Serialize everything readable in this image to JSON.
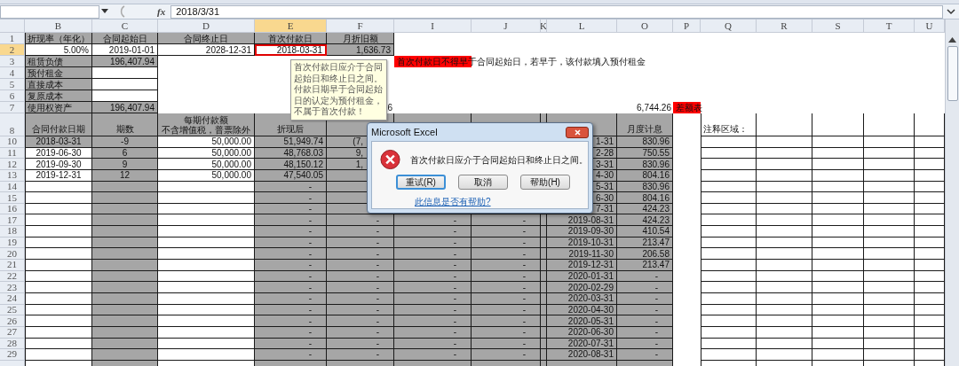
{
  "formula_bar": {
    "function_label": "fx",
    "formula": "2018/3/31"
  },
  "columns": [
    {
      "label": "B",
      "selected": false,
      "data_shaded": false,
      "bordered": true
    },
    {
      "label": "C",
      "selected": false,
      "data_shaded": true,
      "bordered": true
    },
    {
      "label": "D",
      "selected": false,
      "data_shaded": false,
      "bordered": true
    },
    {
      "label": "E",
      "selected": true,
      "data_shaded": true,
      "bordered": true
    },
    {
      "label": "F",
      "selected": false,
      "data_shaded": true,
      "bordered": true
    },
    {
      "label": "I",
      "selected": false,
      "data_shaded": true,
      "bordered": true
    },
    {
      "label": "J",
      "selected": false,
      "data_shaded": true,
      "bordered": true
    },
    {
      "label": "K",
      "selected": false,
      "data_shaded": true,
      "bordered": true
    },
    {
      "label": "L",
      "selected": false,
      "data_shaded": true,
      "bordered": true
    },
    {
      "label": "O",
      "selected": false,
      "data_shaded": true,
      "bordered": true
    },
    {
      "label": "P",
      "selected": false,
      "data_shaded": false,
      "bordered": false
    },
    {
      "label": "Q",
      "selected": false,
      "data_shaded": false,
      "bordered": true
    },
    {
      "label": "R",
      "selected": false,
      "data_shaded": false,
      "bordered": true
    },
    {
      "label": "S",
      "selected": false,
      "data_shaded": false,
      "bordered": true
    },
    {
      "label": "T",
      "selected": false,
      "data_shaded": false,
      "bordered": true
    },
    {
      "label": "U",
      "selected": false,
      "data_shaded": false,
      "bordered": true
    }
  ],
  "rows": [
    {
      "header": "1",
      "selected": false,
      "kind": "top",
      "cells": {
        "B": {
          "text": "折现率（年化）",
          "kind": "heading",
          "shaded": true
        },
        "C": {
          "text": "合同起始日",
          "kind": "heading",
          "shaded": true
        },
        "D": {
          "text": "合同终止日",
          "kind": "heading",
          "shaded": true
        },
        "E": {
          "text": "首次付款日",
          "kind": "heading",
          "shaded": true
        },
        "F": {
          "text": "月折旧额",
          "kind": "heading",
          "shaded": true
        }
      }
    },
    {
      "header": "2",
      "selected": true,
      "kind": "top",
      "cells": {
        "B": {
          "text": "5.00%",
          "kind": "value",
          "shaded": false
        },
        "C": {
          "text": "2019-01-01",
          "kind": "value",
          "shaded": false
        },
        "D": {
          "text": "2028-12-31",
          "kind": "value",
          "shaded": false
        },
        "E": {
          "text": "2018-03-31",
          "kind": "value",
          "shaded": false,
          "active": true
        },
        "F": {
          "text": "1,636.73",
          "kind": "value",
          "shaded": true
        }
      }
    },
    {
      "header": "3",
      "selected": false,
      "kind": "top",
      "cells": {
        "B": {
          "text": "租赁负债",
          "kind": "label",
          "shaded": true
        },
        "C": {
          "text": "196,407.94",
          "kind": "value",
          "shaded": true
        },
        "I": {
          "text": "首次付款日不得早于合同起始日，若早于，该付款填入预付租金",
          "kind": "note",
          "color": "#ff0000"
        }
      }
    },
    {
      "header": "4",
      "selected": false,
      "kind": "top",
      "cells": {
        "B": {
          "text": "预付租金",
          "kind": "label",
          "shaded": true
        },
        "C": {
          "kind": "value",
          "shaded": false
        }
      }
    },
    {
      "header": "5",
      "selected": false,
      "kind": "top",
      "cells": {
        "B": {
          "text": "直接成本",
          "kind": "label",
          "shaded": true
        },
        "C": {
          "kind": "value",
          "shaded": false
        }
      }
    },
    {
      "header": "6",
      "selected": false,
      "kind": "top",
      "cells": {
        "B": {
          "text": "复原成本",
          "kind": "label",
          "shaded": true
        },
        "C": {
          "kind": "value",
          "shaded": false
        }
      }
    },
    {
      "header": "7",
      "selected": false,
      "kind": "top",
      "cells": {
        "B": {
          "text": "使用权资产",
          "kind": "label",
          "shaded": true
        },
        "C": {
          "text": "196,407.94",
          "kind": "value",
          "shaded": true
        },
        "F": {
          "text": "6",
          "kind": "plain"
        },
        "O": {
          "text": "6,744.26",
          "kind": "plain"
        },
        "P": {
          "text": "差额表",
          "kind": "note",
          "color": "#ff0000"
        }
      }
    },
    {
      "header": "8",
      "selected": false,
      "kind": "heading",
      "cells": {
        "B": {
          "text": "合同付款日期",
          "kind": "heading",
          "shaded": true
        },
        "C": {
          "text": "期数",
          "kind": "heading"
        },
        "D": {
          "text": "每期付款额",
          "subtext": "不含增值税，普票除外",
          "kind": "heading",
          "shaded": true
        },
        "E": {
          "text": "折现后",
          "kind": "heading"
        },
        "O": {
          "text": "月度计息",
          "kind": "heading"
        },
        "Q": {
          "text": "注释区域：",
          "kind": "label"
        }
      }
    },
    {
      "header": "10",
      "selected": false,
      "kind": "data",
      "cells": {
        "B": {
          "text": "2018-03-31",
          "kind": "heading",
          "shaded": true
        },
        "C": {
          "text": "-9",
          "kind": "heading"
        },
        "D": {
          "text": "50,000.00",
          "kind": "value"
        },
        "E": {
          "text": "51,949.74",
          "kind": "value"
        },
        "F": {
          "text": "(7,",
          "kind": "cut"
        },
        "L": {
          "text": "1-31",
          "kind": "value"
        },
        "O": {
          "text": "830.96",
          "kind": "value"
        }
      }
    },
    {
      "header": "11",
      "selected": false,
      "kind": "data",
      "cells": {
        "B": {
          "text": "2019-06-30",
          "kind": "heading"
        },
        "C": {
          "text": "6",
          "kind": "heading"
        },
        "D": {
          "text": "50,000.00",
          "kind": "value"
        },
        "E": {
          "text": "48,768.03",
          "kind": "value"
        },
        "F": {
          "text": "9,",
          "kind": "cut"
        },
        "L": {
          "text": "2-28",
          "kind": "value"
        },
        "O": {
          "text": "750.55",
          "kind": "value"
        }
      }
    },
    {
      "header": "12",
      "selected": false,
      "kind": "data",
      "cells": {
        "B": {
          "text": "2019-09-30",
          "kind": "heading"
        },
        "C": {
          "text": "9",
          "kind": "heading"
        },
        "D": {
          "text": "50,000.00",
          "kind": "value"
        },
        "E": {
          "text": "48,150.12",
          "kind": "value"
        },
        "F": {
          "text": "1,",
          "kind": "cut"
        },
        "L": {
          "text": "3-31",
          "kind": "value"
        },
        "O": {
          "text": "830.96",
          "kind": "value"
        }
      }
    },
    {
      "header": "13",
      "selected": false,
      "kind": "data",
      "cells": {
        "B": {
          "text": "2019-12-31",
          "kind": "heading"
        },
        "C": {
          "text": "12",
          "kind": "heading"
        },
        "D": {
          "text": "50,000.00",
          "kind": "value"
        },
        "E": {
          "text": "47,540.05",
          "kind": "value"
        },
        "L": {
          "text": "4-30",
          "kind": "value"
        },
        "O": {
          "text": "804.16",
          "kind": "value"
        }
      }
    },
    {
      "header": "14",
      "selected": false,
      "kind": "data",
      "cells": {
        "E": {
          "text": "-",
          "kind": "dash"
        },
        "L": {
          "text": "5-31",
          "kind": "value"
        },
        "O": {
          "text": "830.96",
          "kind": "value"
        }
      }
    },
    {
      "header": "15",
      "selected": false,
      "kind": "data",
      "cells": {
        "E": {
          "text": "-",
          "kind": "dash"
        },
        "L": {
          "text": "6-30",
          "kind": "value"
        },
        "O": {
          "text": "804.16",
          "kind": "value"
        }
      }
    },
    {
      "header": "16",
      "selected": false,
      "kind": "data",
      "cells": {
        "E": {
          "text": "-",
          "kind": "dash"
        },
        "L": {
          "text": "7-31",
          "kind": "value"
        },
        "O": {
          "text": "424.23",
          "kind": "value"
        }
      }
    },
    {
      "header": "17",
      "selected": false,
      "kind": "data",
      "cells": {
        "E": {
          "text": "-",
          "kind": "dash"
        },
        "F": {
          "text": "-",
          "kind": "dash"
        },
        "I": {
          "text": "-",
          "kind": "dash"
        },
        "J": {
          "text": "-",
          "kind": "dash"
        },
        "L": {
          "text": "2019-08-31",
          "kind": "value"
        },
        "O": {
          "text": "424.23",
          "kind": "value"
        }
      }
    },
    {
      "header": "18",
      "selected": false,
      "kind": "data",
      "cells": {
        "E": {
          "text": "-",
          "kind": "dash"
        },
        "F": {
          "text": "-",
          "kind": "dash"
        },
        "I": {
          "text": "-",
          "kind": "dash"
        },
        "J": {
          "text": "-",
          "kind": "dash"
        },
        "L": {
          "text": "2019-09-30",
          "kind": "value"
        },
        "O": {
          "text": "410.54",
          "kind": "value"
        }
      }
    },
    {
      "header": "19",
      "selected": false,
      "kind": "data",
      "cells": {
        "E": {
          "text": "-",
          "kind": "dash"
        },
        "F": {
          "text": "-",
          "kind": "dash"
        },
        "I": {
          "text": "-",
          "kind": "dash"
        },
        "J": {
          "text": "-",
          "kind": "dash"
        },
        "L": {
          "text": "2019-10-31",
          "kind": "value"
        },
        "O": {
          "text": "213.47",
          "kind": "value"
        }
      }
    },
    {
      "header": "20",
      "selected": false,
      "kind": "data",
      "cells": {
        "E": {
          "text": "-",
          "kind": "dash"
        },
        "F": {
          "text": "-",
          "kind": "dash"
        },
        "I": {
          "text": "-",
          "kind": "dash"
        },
        "J": {
          "text": "-",
          "kind": "dash"
        },
        "L": {
          "text": "2019-11-30",
          "kind": "value"
        },
        "O": {
          "text": "206.58",
          "kind": "value"
        }
      }
    },
    {
      "header": "21",
      "selected": false,
      "kind": "data",
      "cells": {
        "E": {
          "text": "-",
          "kind": "dash"
        },
        "F": {
          "text": "-",
          "kind": "dash"
        },
        "I": {
          "text": "-",
          "kind": "dash"
        },
        "J": {
          "text": "-",
          "kind": "dash"
        },
        "L": {
          "text": "2019-12-31",
          "kind": "value"
        },
        "O": {
          "text": "213.47",
          "kind": "value"
        }
      }
    },
    {
      "header": "22",
      "selected": false,
      "kind": "data",
      "cells": {
        "E": {
          "text": "-",
          "kind": "dash"
        },
        "F": {
          "text": "-",
          "kind": "dash"
        },
        "I": {
          "text": "-",
          "kind": "dash"
        },
        "J": {
          "text": "-",
          "kind": "dash"
        },
        "L": {
          "text": "2020-01-31",
          "kind": "value"
        },
        "O": {
          "text": "-",
          "kind": "dash"
        }
      }
    },
    {
      "header": "23",
      "selected": false,
      "kind": "data",
      "cells": {
        "E": {
          "text": "-",
          "kind": "dash"
        },
        "F": {
          "text": "-",
          "kind": "dash"
        },
        "I": {
          "text": "-",
          "kind": "dash"
        },
        "J": {
          "text": "-",
          "kind": "dash"
        },
        "L": {
          "text": "2020-02-29",
          "kind": "value"
        },
        "O": {
          "text": "-",
          "kind": "dash"
        }
      }
    },
    {
      "header": "24",
      "selected": false,
      "kind": "data",
      "cells": {
        "E": {
          "text": "-",
          "kind": "dash"
        },
        "F": {
          "text": "-",
          "kind": "dash"
        },
        "I": {
          "text": "-",
          "kind": "dash"
        },
        "J": {
          "text": "-",
          "kind": "dash"
        },
        "L": {
          "text": "2020-03-31",
          "kind": "value"
        },
        "O": {
          "text": "-",
          "kind": "dash"
        }
      }
    },
    {
      "header": "25",
      "selected": false,
      "kind": "data",
      "cells": {
        "E": {
          "text": "-",
          "kind": "dash"
        },
        "F": {
          "text": "-",
          "kind": "dash"
        },
        "I": {
          "text": "-",
          "kind": "dash"
        },
        "J": {
          "text": "-",
          "kind": "dash"
        },
        "L": {
          "text": "2020-04-30",
          "kind": "value"
        },
        "O": {
          "text": "-",
          "kind": "dash"
        }
      }
    },
    {
      "header": "26",
      "selected": false,
      "kind": "data",
      "cells": {
        "E": {
          "text": "-",
          "kind": "dash"
        },
        "F": {
          "text": "-",
          "kind": "dash"
        },
        "I": {
          "text": "-",
          "kind": "dash"
        },
        "J": {
          "text": "-",
          "kind": "dash"
        },
        "L": {
          "text": "2020-05-31",
          "kind": "value"
        },
        "O": {
          "text": "-",
          "kind": "dash"
        }
      }
    },
    {
      "header": "27",
      "selected": false,
      "kind": "data",
      "cells": {
        "E": {
          "text": "-",
          "kind": "dash"
        },
        "F": {
          "text": "-",
          "kind": "dash"
        },
        "I": {
          "text": "-",
          "kind": "dash"
        },
        "J": {
          "text": "-",
          "kind": "dash"
        },
        "L": {
          "text": "2020-06-30",
          "kind": "value"
        },
        "O": {
          "text": "-",
          "kind": "dash"
        }
      }
    },
    {
      "header": "28",
      "selected": false,
      "kind": "data",
      "cells": {
        "E": {
          "text": "-",
          "kind": "dash"
        },
        "F": {
          "text": "-",
          "kind": "dash"
        },
        "I": {
          "text": "-",
          "kind": "dash"
        },
        "J": {
          "text": "-",
          "kind": "dash"
        },
        "L": {
          "text": "2020-07-31",
          "kind": "value"
        },
        "O": {
          "text": "-",
          "kind": "dash"
        }
      }
    },
    {
      "header": "29",
      "selected": false,
      "kind": "data",
      "cells": {
        "E": {
          "text": "-",
          "kind": "dash"
        },
        "F": {
          "text": "-",
          "kind": "dash"
        },
        "I": {
          "text": "-",
          "kind": "dash"
        },
        "J": {
          "text": "-",
          "kind": "dash"
        },
        "L": {
          "text": "2020-08-31",
          "kind": "value"
        },
        "O": {
          "text": "-",
          "kind": "dash"
        }
      }
    },
    {
      "selected": false,
      "kind": "data",
      "cells": {}
    }
  ],
  "tooltip": {
    "text": "首次付款日应介于合同起始日和终止日之间。付款日期早于合同起始日的认定为预付租金，不属于首次付款！"
  },
  "dialog": {
    "title": "Microsoft Excel",
    "message": "首次付款日应介于合同起始日和终止日之间。",
    "buttons": [
      {
        "label": "重试(R)",
        "default": true
      },
      {
        "label": "取消",
        "default": false
      },
      {
        "label": "帮助(H)",
        "default": false
      }
    ],
    "link": "此信息是否有帮助?"
  }
}
